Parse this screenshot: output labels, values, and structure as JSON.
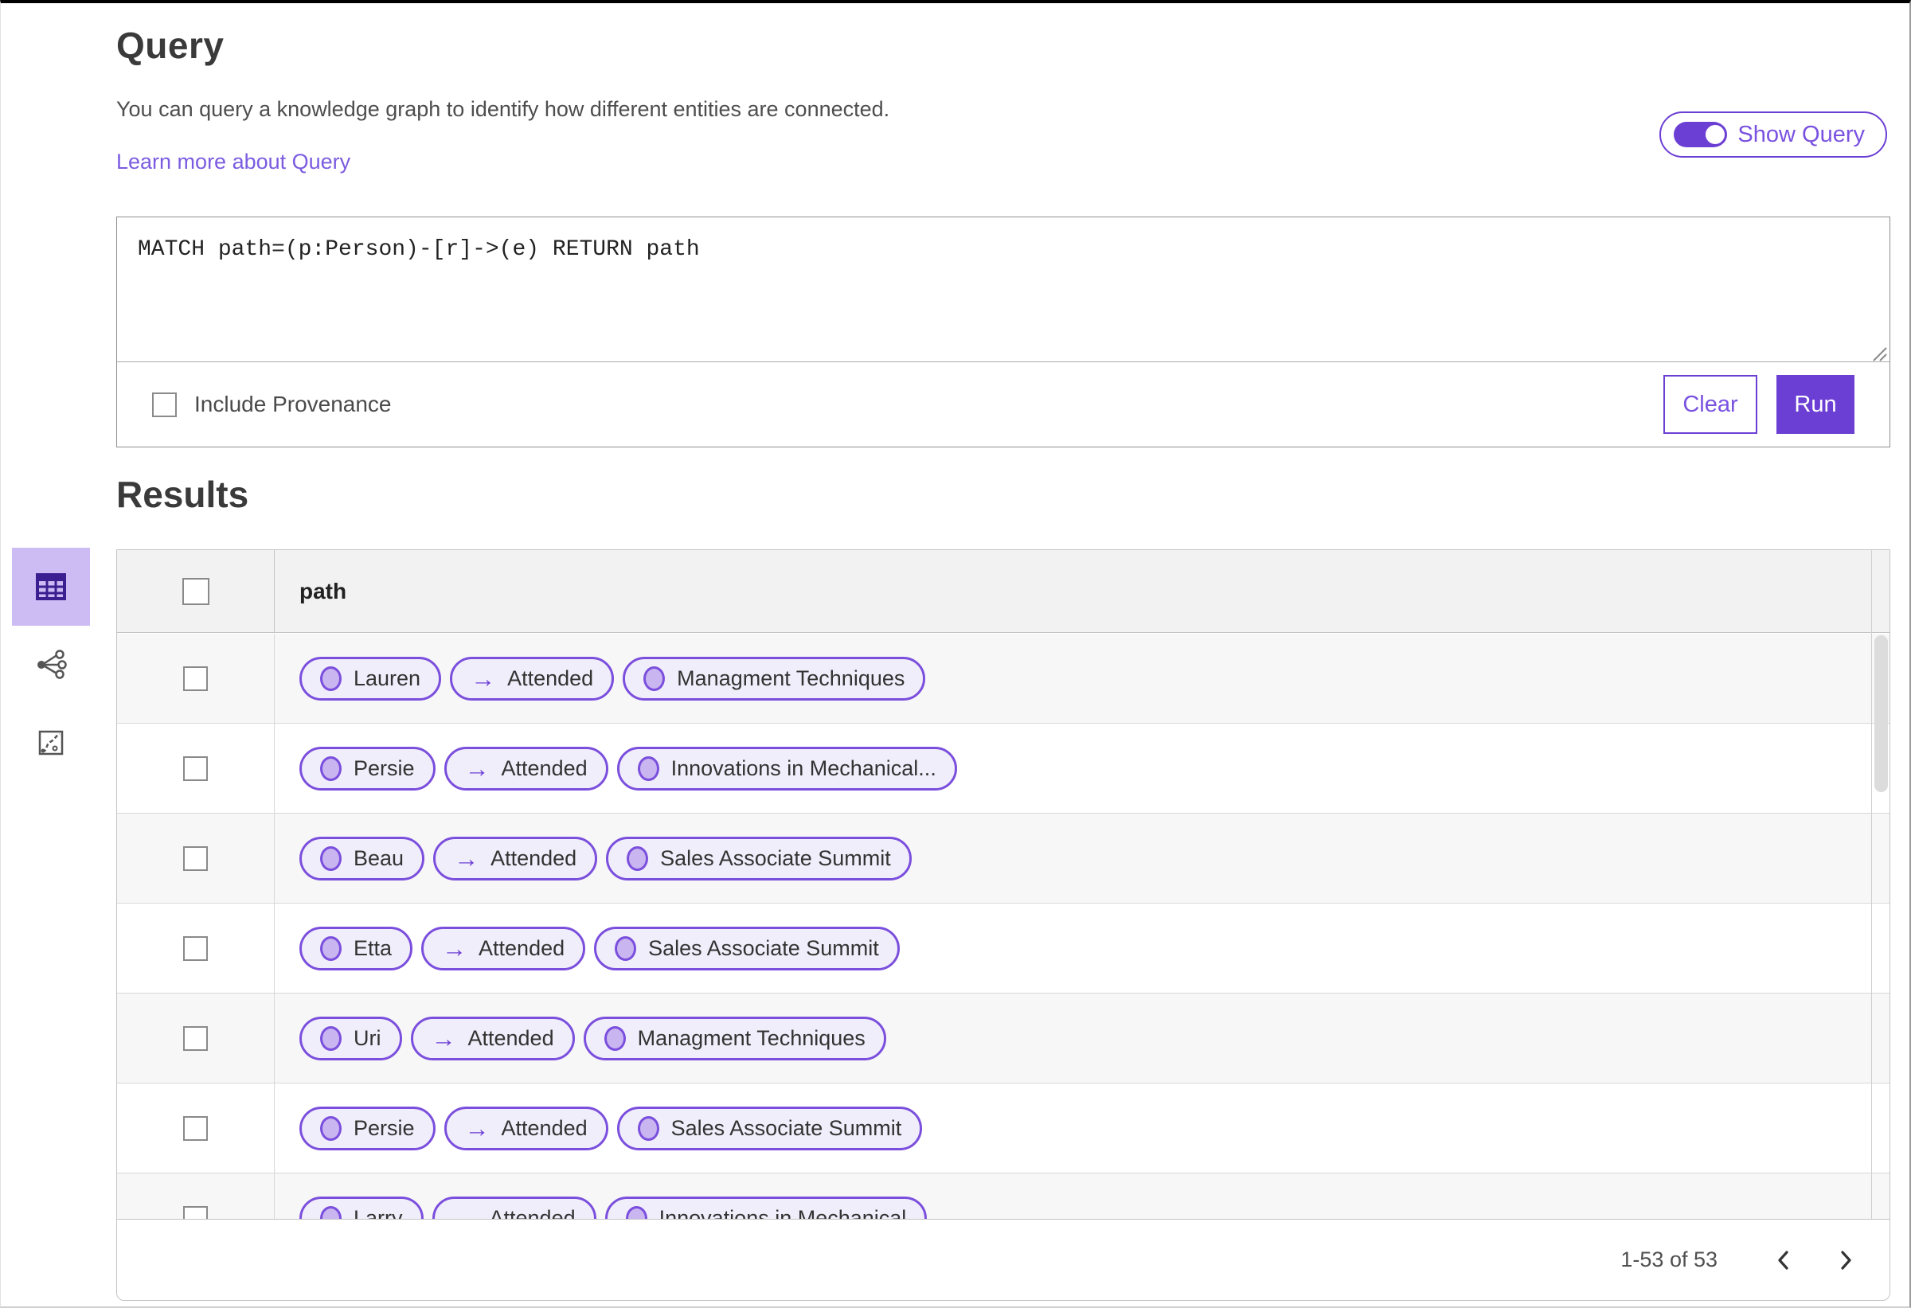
{
  "colors": {
    "accent": "#6c3fd4",
    "accent-text": "#7a52e0",
    "link": "#7b5ce0",
    "pill-border": "#7b4fdd",
    "pill-bg": "#f1eefb",
    "node-fill": "#c9b6f0",
    "tile-bg": "#cdbcf3",
    "icon-deep": "#3b1e90"
  },
  "icons": {
    "arrow_right_glyph": "→"
  },
  "query_panel": {
    "title": "Query",
    "description": "You can query a knowledge graph to identify how different entities are connected.",
    "learn_more_label": "Learn more about Query",
    "show_query_label": "Show Query",
    "show_query_on": true,
    "query_text": "MATCH path=(p:Person)-[r]->(e) RETURN path",
    "include_provenance_label": "Include Provenance",
    "include_provenance_checked": false,
    "clear_label": "Clear",
    "run_label": "Run"
  },
  "results": {
    "title": "Results",
    "view_switcher": [
      {
        "name": "table-view",
        "selected": true
      },
      {
        "name": "graph-view",
        "selected": false
      },
      {
        "name": "chart-view",
        "selected": false
      }
    ],
    "table": {
      "column_header": "path",
      "rows": [
        {
          "source": "Lauren",
          "relation": "Attended",
          "target": "Managment Techniques"
        },
        {
          "source": "Persie",
          "relation": "Attended",
          "target": "Innovations in Mechanical..."
        },
        {
          "source": "Beau",
          "relation": "Attended",
          "target": "Sales Associate Summit"
        },
        {
          "source": "Etta",
          "relation": "Attended",
          "target": "Sales Associate Summit"
        },
        {
          "source": "Uri",
          "relation": "Attended",
          "target": "Managment Techniques"
        },
        {
          "source": "Persie",
          "relation": "Attended",
          "target": "Sales Associate Summit"
        },
        {
          "source": "Larry",
          "relation": "Attended",
          "target": "Innovations in Mechanical"
        }
      ]
    },
    "pagination": {
      "range_label": "1-53 of 53"
    }
  }
}
